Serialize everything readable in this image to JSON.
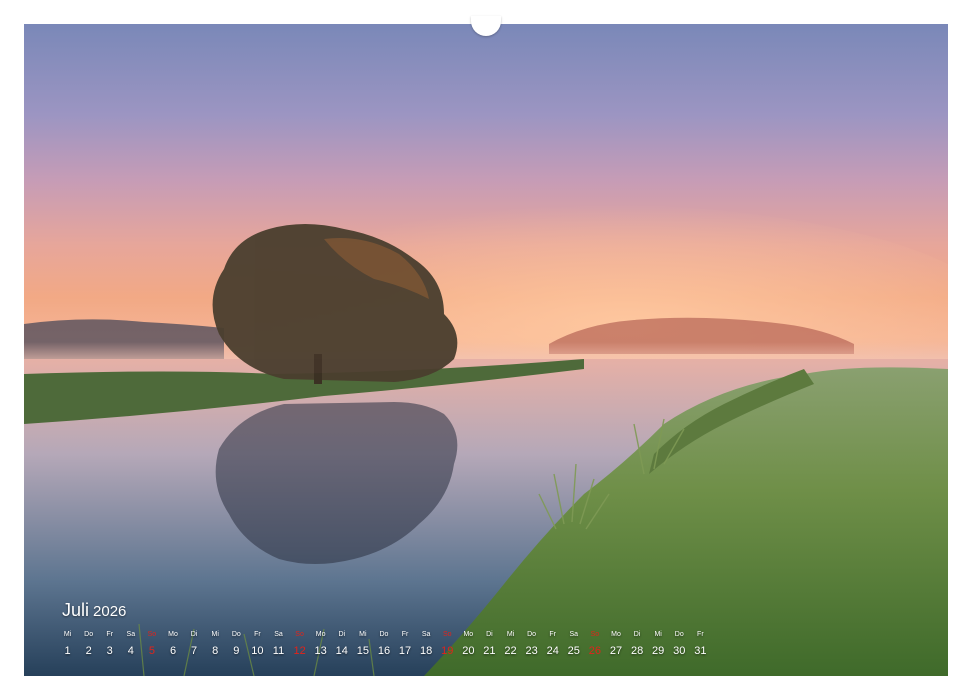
{
  "calendar": {
    "month": "Juli",
    "year": "2026",
    "sunday_color": "#e2231a",
    "days": [
      {
        "wd": "Mi",
        "num": "1"
      },
      {
        "wd": "Do",
        "num": "2"
      },
      {
        "wd": "Fr",
        "num": "3"
      },
      {
        "wd": "Sa",
        "num": "4"
      },
      {
        "wd": "So",
        "num": "5"
      },
      {
        "wd": "Mo",
        "num": "6"
      },
      {
        "wd": "Di",
        "num": "7"
      },
      {
        "wd": "Mi",
        "num": "8"
      },
      {
        "wd": "Do",
        "num": "9"
      },
      {
        "wd": "Fr",
        "num": "10"
      },
      {
        "wd": "Sa",
        "num": "11"
      },
      {
        "wd": "So",
        "num": "12"
      },
      {
        "wd": "Mo",
        "num": "13"
      },
      {
        "wd": "Di",
        "num": "14"
      },
      {
        "wd": "Mi",
        "num": "15"
      },
      {
        "wd": "Do",
        "num": "16"
      },
      {
        "wd": "Fr",
        "num": "17"
      },
      {
        "wd": "Sa",
        "num": "18"
      },
      {
        "wd": "So",
        "num": "19"
      },
      {
        "wd": "Mo",
        "num": "20"
      },
      {
        "wd": "Di",
        "num": "21"
      },
      {
        "wd": "Mi",
        "num": "22"
      },
      {
        "wd": "Do",
        "num": "23"
      },
      {
        "wd": "Fr",
        "num": "24"
      },
      {
        "wd": "Sa",
        "num": "25"
      },
      {
        "wd": "So",
        "num": "26"
      },
      {
        "wd": "Mo",
        "num": "27"
      },
      {
        "wd": "Di",
        "num": "28"
      },
      {
        "wd": "Mi",
        "num": "29"
      },
      {
        "wd": "Do",
        "num": "30"
      },
      {
        "wd": "Fr",
        "num": "31"
      }
    ]
  }
}
